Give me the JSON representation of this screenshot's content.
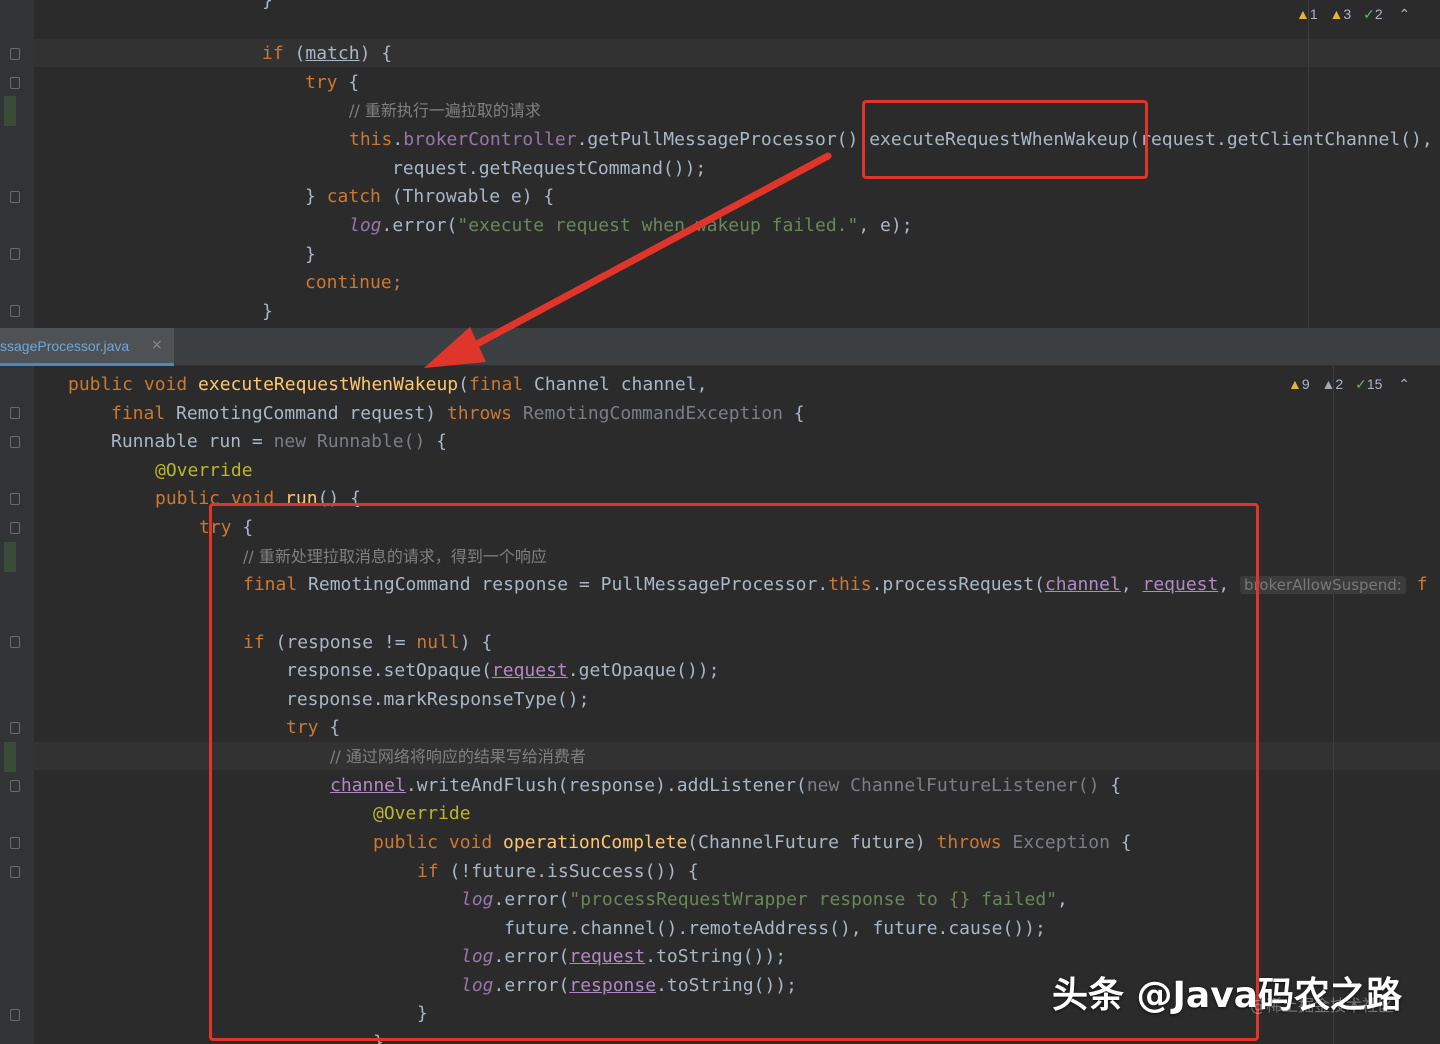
{
  "top_editor": {
    "inspections": {
      "warn1": "1",
      "warn2": "3",
      "ok": "2"
    },
    "lines": {
      "brace_top": "}",
      "if_kw": "if",
      "if_cond_open": " (",
      "if_cond": "match",
      "if_cond_close": ") {",
      "try_kw": "try",
      "try_brace": " {",
      "comment1": "// 重新执行一遍拉取的请求",
      "this_kw": "this",
      "dot1": ".",
      "broker_field": "brokerController",
      "call1": ".getPullMessageProcessor()",
      "call2": ".executeRequestWhenWakeup(",
      "call2_args": "request.getClientChannel(),",
      "line_request_cmd": "request.getRequestCommand());",
      "catch_close": "} ",
      "catch_kw": "catch",
      "catch_rest": " (Throwable e) {",
      "log_obj": "log",
      "log_call": ".error(",
      "log_str": "\"execute request when wakeup failed.\"",
      "log_rest": ", e);",
      "inner_close": "}",
      "continue_kw": "continue;",
      "outer_close": "}"
    }
  },
  "tab": {
    "filename": "ssageProcessor.java",
    "close_icon": "×"
  },
  "bottom_editor": {
    "inspections": {
      "warn1": "9",
      "warn2": "2",
      "ok": "15"
    },
    "lines": {
      "l1_public": "public void ",
      "l1_fn": "executeRequestWhenWakeup",
      "l1_open": "(",
      "l1_final": "final",
      "l1_rest": " Channel channel,",
      "l2_final": "final",
      "l2_mid": " RemotingCommand request) ",
      "l2_throws": "throws",
      "l2_exc": " RemotingCommandException",
      "l2_brace": " {",
      "l3_a": "Runnable run = ",
      "l3_new": "new Runnable()",
      "l3_b": " {",
      "l4_ann": "@Override",
      "l5_public": "public void ",
      "l5_fn": "run",
      "l5_rest": "() {",
      "l6_try": "try",
      "l6_b": " {",
      "l7_comment": "// 重新处理拉取消息的请求，得到一个响应",
      "l8_final": "final",
      "l8_a": " RemotingCommand response = PullMessageProcessor.",
      "l8_this": "this",
      "l8_b": ".processRequest(",
      "l8_ch": "channel",
      "l8_c": ", ",
      "l8_req": "request",
      "l8_d": ",",
      "l8_hint": "brokerAllowSuspend:",
      "l8_f": " f",
      "l10_if": "if",
      "l10_a": " (response != ",
      "l10_null": "null",
      "l10_b": ") {",
      "l11_a": "response.setOpaque(",
      "l11_req": "request",
      "l11_b": ".getOpaque());",
      "l12": "response.markResponseType();",
      "l13_try": "try",
      "l13_b": " {",
      "l14_comment": "// 通过网络将响应的结果写给消费者",
      "l15_ch": "channel",
      "l15_a": ".writeAndFlush(response).addListener(",
      "l15_new": "new ChannelFutureListener()",
      "l15_b": " {",
      "l16_ann": "@Override",
      "l17_public": "public void ",
      "l17_fn": "operationComplete",
      "l17_a": "(ChannelFuture future) ",
      "l17_throws": "throws",
      "l17_exc": " Exception",
      "l17_b": " {",
      "l18_if": "if",
      "l18_a": " (!future.isSuccess()) {",
      "l19_log": "log",
      "l19_a": ".error(",
      "l19_str": "\"processRequestWrapper response to {} failed\"",
      "l19_b": ",",
      "l20": "future.channel().remoteAddress(), future.cause());",
      "l21_log": "log",
      "l21_a": ".error(",
      "l21_req": "request",
      "l21_b": ".toString());",
      "l22_log": "log",
      "l22_a": ".error(",
      "l22_resp": "response",
      "l22_b": ".toString());",
      "l23": "}",
      "l24": "}"
    }
  },
  "watermark": {
    "main": "头条 @Java码农之路",
    "sub": "@稀土掘金技术社区"
  },
  "colors": {
    "annotation_red": "#e0352b",
    "editor_bg": "#2b2b2b",
    "keyword": "#cc7832",
    "function": "#ffc66d",
    "string": "#6a8759"
  }
}
